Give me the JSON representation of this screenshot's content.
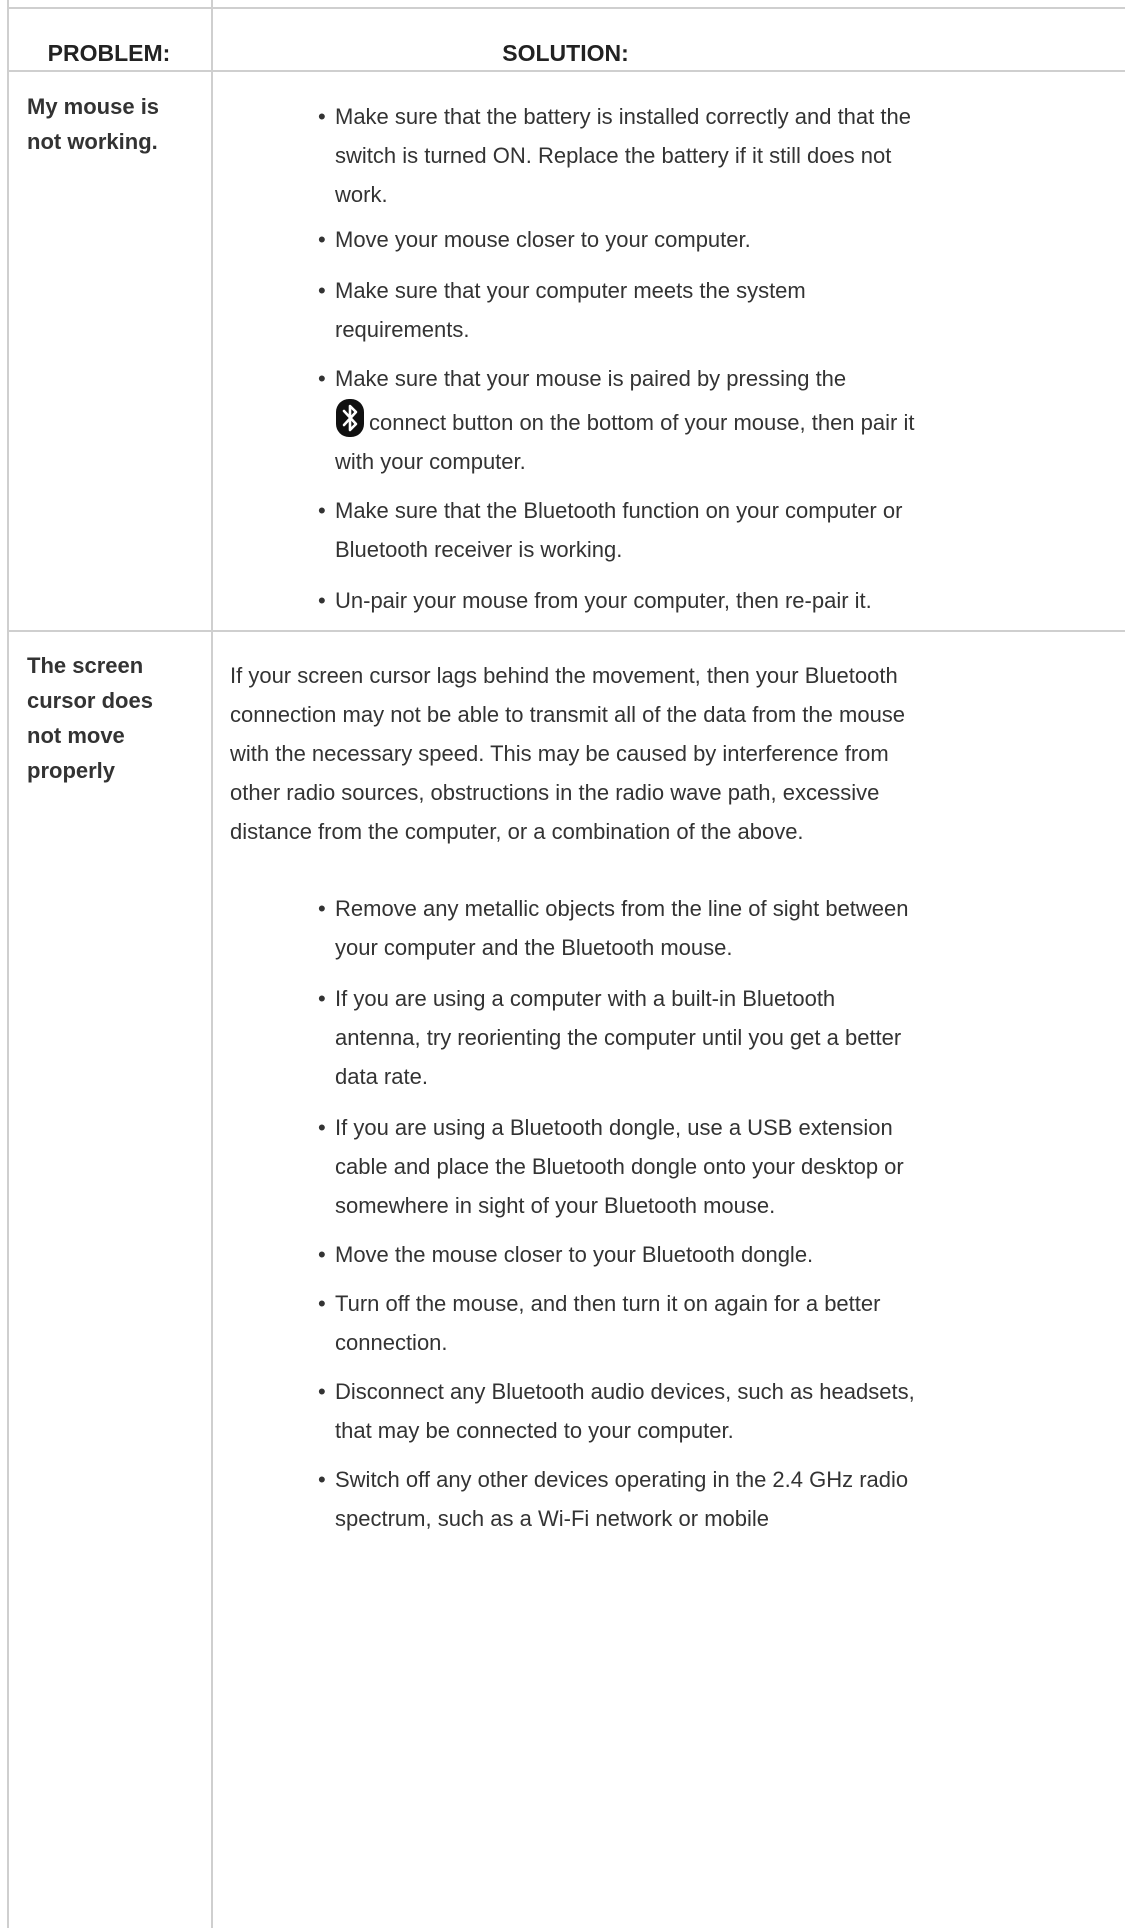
{
  "table": {
    "header": {
      "problem": "PROBLEM:",
      "solution": "SOLUTION:"
    },
    "rows": [
      {
        "problem": "My mouse is not working.",
        "bullets": [
          "Make sure that the battery is installed correctly and that the switch is turned ON. Replace the battery if it still does not work.",
          "Move your mouse closer to your computer.",
          "Make sure that your computer meets the system requirements.",
          {
            "before": "Make sure that your mouse is paired by pressing the",
            "icon": "bluetooth-icon",
            "after": "connect button on the bottom of your mouse, then pair it with your computer."
          },
          "Make sure that the Bluetooth function on your computer or Bluetooth receiver is working.",
          "Un-pair your mouse from your computer, then re-pair it."
        ]
      },
      {
        "problem": "The screen cursor does not move properly",
        "paragraph": "If your screen cursor lags behind the movement, then your Bluetooth connection may not be able to transmit all of the data from the mouse with the necessary speed. This may be caused by interference from other radio sources, obstructions in the radio wave path, excessive distance from the computer, or a combination of the above.",
        "bullets": [
          "Remove any metallic objects from the line of sight between your computer and the Bluetooth mouse.",
          "If you are using a computer with a built-in Bluetooth antenna, try reorienting the computer until you get a better data rate.",
          "If you are using a Bluetooth dongle, use a USB extension cable and place the Bluetooth dongle onto your desktop or somewhere in sight of your Bluetooth mouse.",
          "Move the mouse closer to your Bluetooth dongle.",
          "Turn off the mouse, and then turn it on again for a better connection.",
          "Disconnect any Bluetooth audio devices, such as headsets, that may be connected to your computer.",
          "Switch off any other devices operating in the 2.4 GHz radio spectrum, such as a Wi-Fi network or mobile"
        ]
      }
    ]
  }
}
